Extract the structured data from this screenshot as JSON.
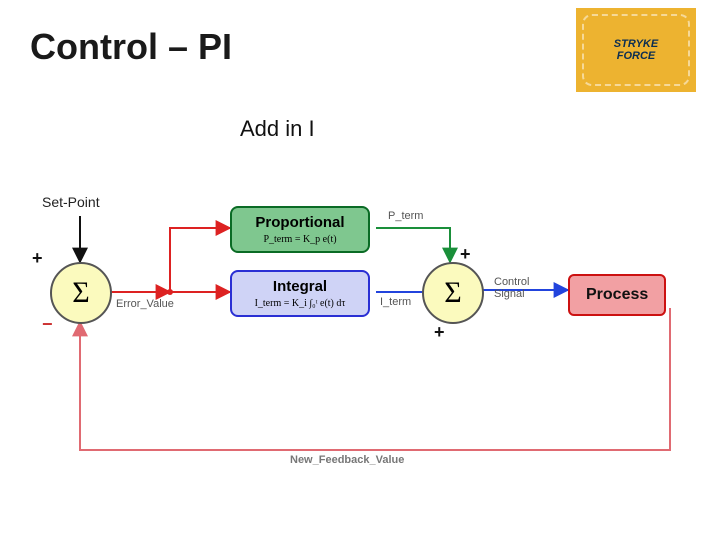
{
  "title": "Control – PI",
  "subtitle": "Add in I",
  "logo": {
    "line1": "STRYKE",
    "line2": "FORCE"
  },
  "labels": {
    "setpoint": "Set-Point",
    "error": "Error_Value",
    "p_term": "P_term",
    "i_term": "I_term",
    "control_signal1": "Control",
    "control_signal2": "Signal",
    "feedback": "New_Feedback_Value"
  },
  "signs": {
    "sum1_top": "+",
    "sum1_bottom": "−",
    "sum2_top": "+",
    "sum2_bottom": "+"
  },
  "blocks": {
    "proportional": {
      "title": "Proportional",
      "equation": "P_term = K_p e(t)"
    },
    "integral": {
      "title": "Integral",
      "equation": "I_term = K_i ∫₀ᵗ e(t) dτ"
    },
    "process": {
      "title": "Process"
    }
  },
  "sigma": "Σ"
}
